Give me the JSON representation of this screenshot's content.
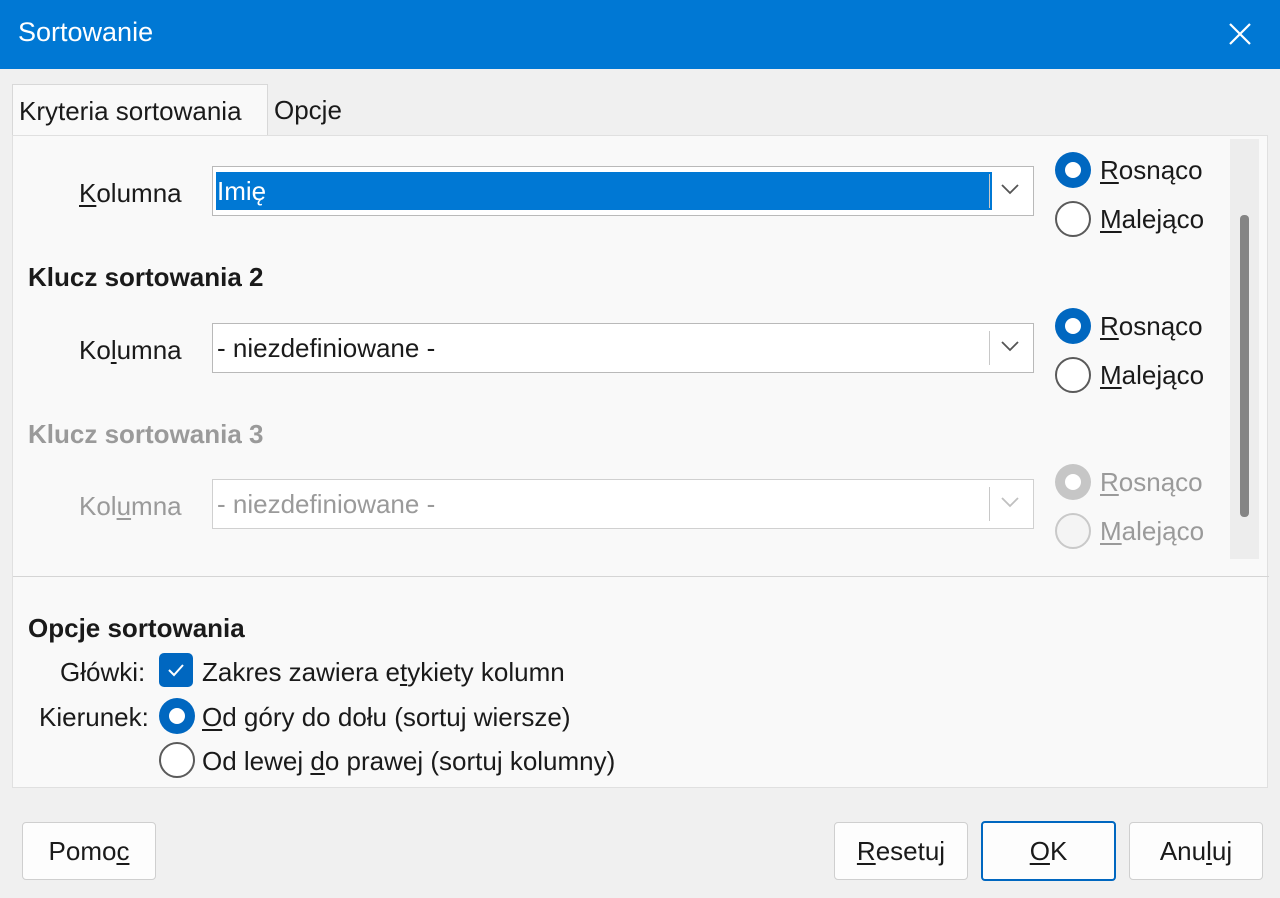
{
  "window": {
    "title": "Sortowanie"
  },
  "tabs": [
    {
      "label": "Kryteria sortowania",
      "active": true
    },
    {
      "label": "Opcje",
      "active": false
    }
  ],
  "key1": {
    "column_label_pre": "",
    "column_label_u": "K",
    "column_label_post": "olumna",
    "column_value": "Imię",
    "asc_u": "R",
    "asc_rest": "osnąco",
    "desc_u": "M",
    "desc_rest": "alejąco",
    "selected": "asc"
  },
  "key2": {
    "heading": "Klucz sortowania 2",
    "column_label_pre": "Ko",
    "column_label_u": "l",
    "column_label_post": "umna",
    "column_value": "- niezdefiniowane -",
    "asc_u": "R",
    "asc_rest": "osnąco",
    "desc_u": "M",
    "desc_rest": "alejąco",
    "selected": "asc"
  },
  "key3": {
    "heading": "Klucz sortowania 3",
    "column_label_pre": "Kol",
    "column_label_u": "u",
    "column_label_post": "mna",
    "column_value": "- niezdefiniowane -",
    "asc_u": "R",
    "asc_rest": "osnąco",
    "desc_u": "M",
    "desc_rest": "alejąco",
    "selected": "asc",
    "disabled": true
  },
  "options": {
    "heading": "Opcje sortowania",
    "headers_label": "Główki:",
    "headers_check_pre": "Zakres zawiera e",
    "headers_check_u": "t",
    "headers_check_post": "ykiety kolumn",
    "headers_checked": true,
    "direction_label": "Kierunek:",
    "dir1_u": "O",
    "dir1_rest": "d góry do dołu (sortuj wiersze)",
    "dir2_pre": "Od lewej ",
    "dir2_u": "d",
    "dir2_post": "o prawej (sortuj kolumny)",
    "direction_selected": "top-to-bottom"
  },
  "buttons": {
    "help_pre": "Pomo",
    "help_u": "c",
    "reset_u": "R",
    "reset_rest": "esetuj",
    "ok_u": "O",
    "ok_rest": "K",
    "cancel_pre": "Anu",
    "cancel_u": "l",
    "cancel_post": "uj"
  },
  "colors": {
    "accent": "#0078d4",
    "selection": "#0078d4",
    "radio_on": "#0067c0"
  }
}
